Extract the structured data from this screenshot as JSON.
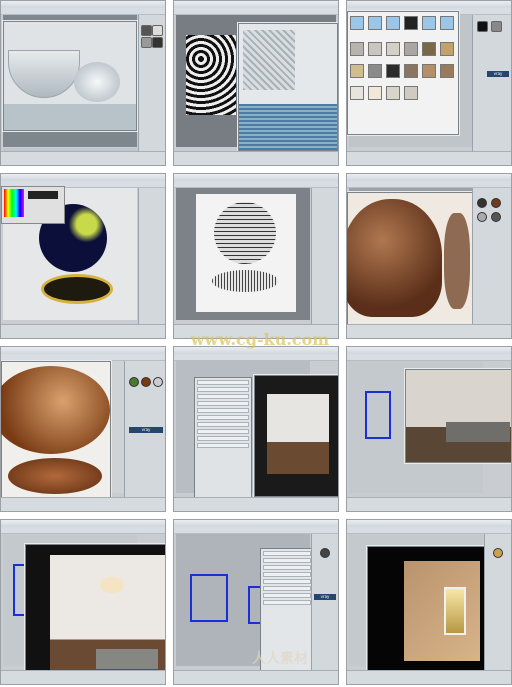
{
  "panels": [
    {
      "id": 1,
      "scene": "glass material preview"
    },
    {
      "id": 2,
      "scene": "rough texture wall render"
    },
    {
      "id": 3,
      "scene": "material texture browser"
    },
    {
      "id": 4,
      "scene": "dark sphere with color picker"
    },
    {
      "id": 5,
      "scene": "wireframe sphere"
    },
    {
      "id": 6,
      "scene": "fabric covered sphere"
    },
    {
      "id": 7,
      "scene": "wooden bowl closeup"
    },
    {
      "id": 8,
      "scene": "render settings dialog room"
    },
    {
      "id": 9,
      "scene": "room wireframe and render"
    },
    {
      "id": 10,
      "scene": "lit living room render"
    },
    {
      "id": 11,
      "scene": "scene with windows settings"
    },
    {
      "id": 12,
      "scene": "progressive interior render"
    }
  ],
  "vray_label": "vray",
  "watermark": "www.cg-ku.com",
  "watermark2": "人人素材",
  "colors": {
    "ui_gray": "#c9ccd0",
    "vray_blue": "#24466f",
    "window_blue": "#1b2fd6",
    "watermark_gold": "#d8c25a"
  }
}
